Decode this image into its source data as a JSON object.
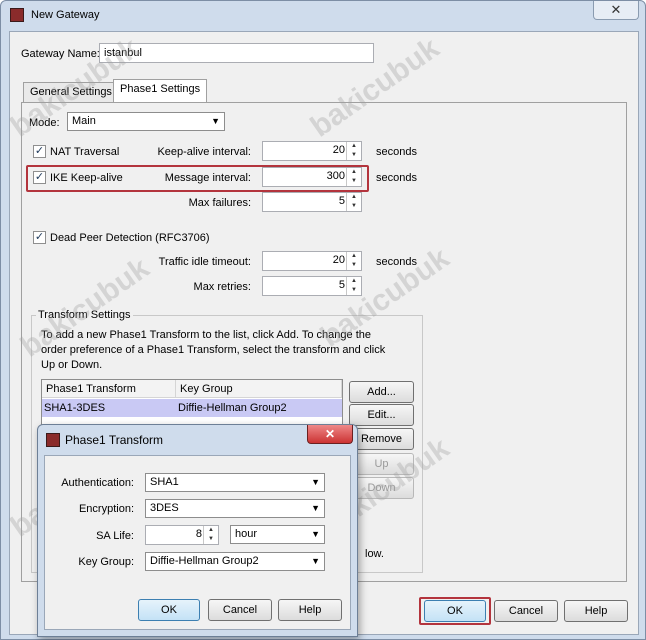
{
  "main_window": {
    "title": "New Gateway",
    "close_glyph": "✕"
  },
  "gateway_name": {
    "label": "Gateway Name:",
    "value": "istanbul"
  },
  "tabs": [
    {
      "label": "General Settings",
      "active": false
    },
    {
      "label": "Phase1 Settings",
      "active": true
    }
  ],
  "mode": {
    "label": "Mode:",
    "value": "Main"
  },
  "nat_traversal": {
    "label": "NAT Traversal",
    "checked": true,
    "interval_label": "Keep-alive interval:",
    "interval_value": "20",
    "unit": "seconds"
  },
  "ike_keepalive": {
    "label": "IKE Keep-alive",
    "checked": true,
    "interval_label": "Message interval:",
    "interval_value": "300",
    "unit": "seconds"
  },
  "max_failures": {
    "label": "Max failures:",
    "value": "5"
  },
  "dpd": {
    "label": "Dead Peer Detection (RFC3706)",
    "checked": true
  },
  "traffic_idle": {
    "label": "Traffic idle timeout:",
    "value": "20",
    "unit": "seconds"
  },
  "max_retries": {
    "label": "Max retries:",
    "value": "5"
  },
  "transform_settings": {
    "legend": "Transform Settings",
    "help_line1": "To add a new Phase1 Transform to the list, click Add. To change the",
    "help_line2": "order preference of a Phase1 Transform, select the transform and click",
    "help_line3": "Up or Down.",
    "columns": [
      "Phase1 Transform",
      "Key Group"
    ],
    "rows": [
      {
        "transform": "SHA1-3DES",
        "key_group": "Diffie-Hellman Group2"
      }
    ],
    "buttons": {
      "add": "Add...",
      "edit": "Edit...",
      "remove": "Remove",
      "up": "Up",
      "down": "Down"
    },
    "bottom_text_fragment": "low."
  },
  "footer": {
    "ok": "OK",
    "cancel": "Cancel",
    "help": "Help"
  },
  "dialog": {
    "title": "Phase1 Transform",
    "close_glyph": "✕",
    "authentication": {
      "label": "Authentication:",
      "value": "SHA1"
    },
    "encryption": {
      "label": "Encryption:",
      "value": "3DES"
    },
    "sa_life": {
      "label": "SA Life:",
      "value": "8",
      "unit": "hour"
    },
    "key_group": {
      "label": "Key Group:",
      "value": "Diffie-Hellman Group2"
    },
    "buttons": {
      "ok": "OK",
      "cancel": "Cancel",
      "help": "Help"
    }
  },
  "watermark": "bakicubuk",
  "colors": {
    "highlight": "#b3343d",
    "selection": "#c9c9f4",
    "frame": "#cfdcec"
  }
}
